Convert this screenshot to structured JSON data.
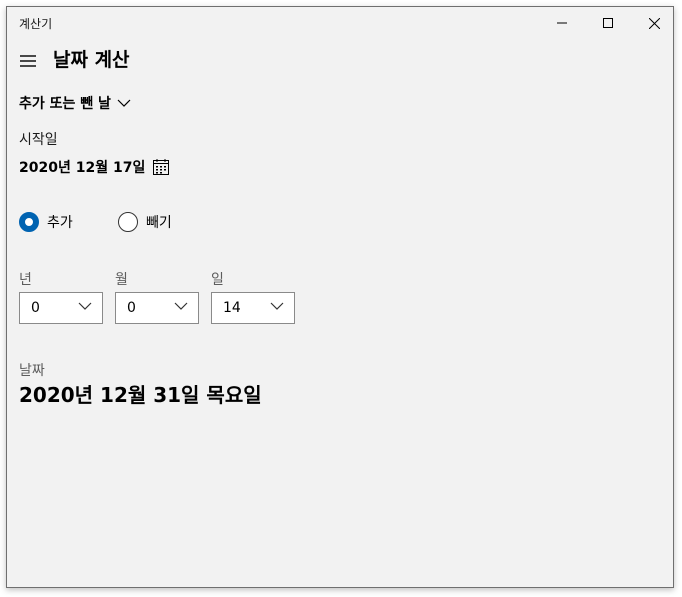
{
  "window": {
    "title": "계산기"
  },
  "header": {
    "title": "날짜 계산"
  },
  "mode": {
    "selected": "추가 또는 뺀 날"
  },
  "start": {
    "label": "시작일",
    "date": "2020년 12월 17일"
  },
  "operation": {
    "add_label": "추가",
    "subtract_label": "빼기",
    "selected": "add"
  },
  "offset": {
    "year_label": "년",
    "year_value": "0",
    "month_label": "월",
    "month_value": "0",
    "day_label": "일",
    "day_value": "14"
  },
  "result": {
    "label": "날짜",
    "date": "2020년 12월 31일 목요일"
  },
  "colors": {
    "accent": "#0063b1",
    "background": "#f2f2f2"
  },
  "icons": {
    "menu": "hamburger-icon",
    "dropdown": "chevron-down-icon",
    "calendar": "calendar-icon",
    "minimize": "minimize-icon",
    "maximize": "maximize-icon",
    "close": "close-icon"
  }
}
